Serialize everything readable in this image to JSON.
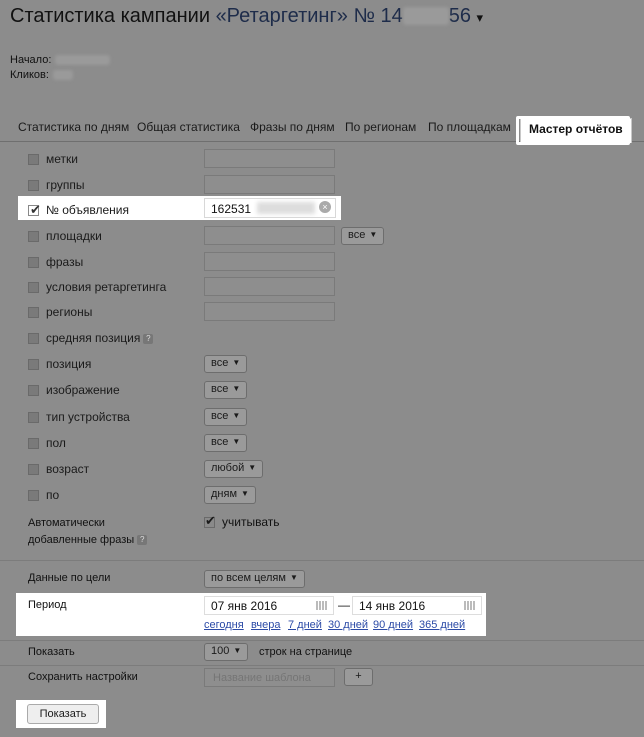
{
  "title": {
    "prefix": "Статистика кампании",
    "campaign": "«Ретаргетинг»",
    "number_start": "№ 14",
    "number_end": "56",
    "caret": "▾"
  },
  "meta": {
    "start_label": "Начало:",
    "clicks_label": "Кликов:"
  },
  "tabs": [
    {
      "label": "Статистика по дням"
    },
    {
      "label": "Общая статистика"
    },
    {
      "label": "Фразы по дням"
    },
    {
      "label": "По регионам"
    },
    {
      "label": "По площадкам"
    },
    {
      "label": "Мастер отчётов"
    }
  ],
  "filters": {
    "metki": "метки",
    "gruppy": "группы",
    "ad_number": "№ объявления",
    "ad_number_value": "162531",
    "ploshchadki": "площадки",
    "ploshchadki_select": "все",
    "frazy": "фразы",
    "usloviya": "условия ретаргетинга",
    "regiony": "регионы",
    "srednyaya": "средняя позиция",
    "help": "?",
    "pozitsiya": "позиция",
    "pozitsiya_select": "все",
    "izobrazhenie": "изображение",
    "izobrazhenie_select": "все",
    "tip": "тип устройства",
    "tip_select": "все",
    "pol": "пол",
    "pol_select": "все",
    "vozrast": "возраст",
    "vozrast_select": "любой",
    "po": "по",
    "po_select": "дням"
  },
  "auto_phrases": {
    "line1": "Автоматически",
    "line2": "добавленные фразы",
    "checkbox_label": "учитывать"
  },
  "goal": {
    "label": "Данные по цели",
    "select": "по всем целям"
  },
  "period": {
    "label": "Период",
    "from": "07 янв 2016",
    "dash": "—",
    "to": "14 янв 2016",
    "quick": [
      "сегодня",
      "вчера",
      "7 дней",
      "30 дней",
      "90 дней",
      "365 дней"
    ]
  },
  "show": {
    "label": "Показать",
    "select": "100",
    "suffix": "строк на странице"
  },
  "save": {
    "label": "Сохранить настройки",
    "placeholder": "Название шаблона",
    "add": "+"
  },
  "submit": "Показать"
}
